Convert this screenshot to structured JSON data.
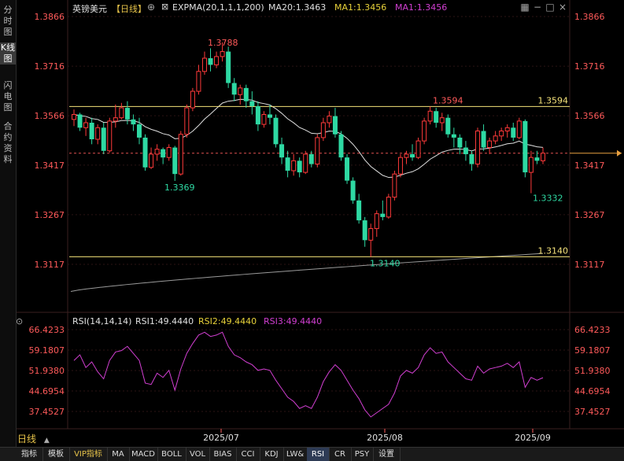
{
  "left_tabs": [
    "分时图",
    "K线图",
    "闪电图",
    "合约资料"
  ],
  "header": {
    "symbol": "英镑美元",
    "period_tag": "【日线】",
    "expma_label": "EXPMA(20,1,1,1,200)",
    "ma20_label": "MA20:1.3463",
    "ma1a_label": "MA1:1.3456",
    "ma1b_label": "MA1:1.3456"
  },
  "rsi_header": {
    "name": "RSI(14,14,14)",
    "rsi1": "RSI1:49.4440",
    "rsi2": "RSI2:49.4440",
    "rsi3": "RSI3:49.4440"
  },
  "colors": {
    "up": "#ff3a3a",
    "down": "#2ed9a3",
    "ema20": "#e0e0e0",
    "ema200": "#9a9a9a",
    "hline": "#f5e27a",
    "rsi": "#d23fd2",
    "axis_label": "#ff5a5a"
  },
  "price_axis": {
    "labels": [
      "1.3866",
      "1.3716",
      "1.3566",
      "1.3417",
      "1.3267",
      "1.3117"
    ],
    "ylim": [
      1.3117,
      1.3866
    ]
  },
  "rsi_axis": {
    "labels": [
      "66.4233",
      "59.1807",
      "51.9380",
      "44.6954",
      "37.4527"
    ],
    "ylim": [
      37.4527,
      66.4233
    ]
  },
  "x_dates": [
    "2025/07",
    "2025/08",
    "2025/09"
  ],
  "annotations": {
    "high_label": "1.3788",
    "low1_label": "1.3369",
    "peak2_label": "1.3594",
    "low2_label": "1.3140",
    "last_low_label": "1.3332",
    "resistance_label": "1.3594",
    "support_label": "1.3140"
  },
  "bottom_period": "日线",
  "bottom_tabs": [
    "指标",
    "模板",
    "VIP指标",
    "MA",
    "MACD",
    "BOLL",
    "VOL",
    "BIAS",
    "CCI",
    "KDJ",
    "LW&",
    "RSI",
    "CR",
    "PSY",
    "设置"
  ],
  "chart_data": {
    "type": "candlestick",
    "title": "英镑美元 日线",
    "ylim": [
      1.3117,
      1.3866
    ],
    "support": 1.314,
    "resistance": 1.3594,
    "current_price": 1.3453,
    "candles": [
      [
        1.3555,
        1.3585,
        1.3535,
        1.357
      ],
      [
        1.357,
        1.3575,
        1.352,
        1.353
      ],
      [
        1.353,
        1.356,
        1.3505,
        1.3545
      ],
      [
        1.3545,
        1.356,
        1.348,
        1.3495
      ],
      [
        1.3495,
        1.354,
        1.348,
        1.353
      ],
      [
        1.353,
        1.3545,
        1.345,
        1.346
      ],
      [
        1.346,
        1.356,
        1.3455,
        1.355
      ],
      [
        1.355,
        1.36,
        1.353,
        1.356
      ],
      [
        1.356,
        1.3605,
        1.3555,
        1.359
      ],
      [
        1.359,
        1.361,
        1.354,
        1.3555
      ],
      [
        1.3555,
        1.357,
        1.352,
        1.354
      ],
      [
        1.354,
        1.356,
        1.348,
        1.35
      ],
      [
        1.35,
        1.351,
        1.34,
        1.341
      ],
      [
        1.341,
        1.347,
        1.3405,
        1.345
      ],
      [
        1.345,
        1.348,
        1.343,
        1.3465
      ],
      [
        1.3465,
        1.347,
        1.342,
        1.344
      ],
      [
        1.344,
        1.348,
        1.343,
        1.347
      ],
      [
        1.347,
        1.3475,
        1.3369,
        1.339
      ],
      [
        1.339,
        1.352,
        1.3385,
        1.351
      ],
      [
        1.351,
        1.36,
        1.35,
        1.359
      ],
      [
        1.359,
        1.365,
        1.358,
        1.364
      ],
      [
        1.364,
        1.372,
        1.363,
        1.37
      ],
      [
        1.37,
        1.376,
        1.369,
        1.374
      ],
      [
        1.374,
        1.377,
        1.37,
        1.372
      ],
      [
        1.372,
        1.376,
        1.371,
        1.3745
      ],
      [
        1.3745,
        1.3788,
        1.373,
        1.376
      ],
      [
        1.376,
        1.3775,
        1.365,
        1.3665
      ],
      [
        1.3665,
        1.368,
        1.361,
        1.363
      ],
      [
        1.363,
        1.366,
        1.36,
        1.365
      ],
      [
        1.365,
        1.366,
        1.359,
        1.361
      ],
      [
        1.361,
        1.364,
        1.357,
        1.3595
      ],
      [
        1.3595,
        1.361,
        1.352,
        1.354
      ],
      [
        1.354,
        1.358,
        1.353,
        1.357
      ],
      [
        1.357,
        1.36,
        1.354,
        1.356
      ],
      [
        1.356,
        1.357,
        1.347,
        1.348
      ],
      [
        1.348,
        1.35,
        1.342,
        1.344
      ],
      [
        1.344,
        1.346,
        1.338,
        1.34
      ],
      [
        1.34,
        1.345,
        1.3385,
        1.343
      ],
      [
        1.343,
        1.344,
        1.338,
        1.3395
      ],
      [
        1.3395,
        1.346,
        1.339,
        1.345
      ],
      [
        1.345,
        1.346,
        1.341,
        1.342
      ],
      [
        1.342,
        1.351,
        1.341,
        1.35
      ],
      [
        1.35,
        1.356,
        1.349,
        1.3545
      ],
      [
        1.3545,
        1.358,
        1.353,
        1.3565
      ],
      [
        1.3565,
        1.359,
        1.35,
        1.351
      ],
      [
        1.351,
        1.352,
        1.343,
        1.344
      ],
      [
        1.344,
        1.345,
        1.336,
        1.337
      ],
      [
        1.337,
        1.338,
        1.33,
        1.331
      ],
      [
        1.331,
        1.333,
        1.324,
        1.325
      ],
      [
        1.325,
        1.326,
        1.317,
        1.319
      ],
      [
        1.319,
        1.324,
        1.314,
        1.3225
      ],
      [
        1.3225,
        1.328,
        1.32,
        1.327
      ],
      [
        1.327,
        1.331,
        1.325,
        1.326
      ],
      [
        1.326,
        1.333,
        1.3255,
        1.332
      ],
      [
        1.332,
        1.34,
        1.331,
        1.339
      ],
      [
        1.339,
        1.345,
        1.338,
        1.344
      ],
      [
        1.344,
        1.346,
        1.342,
        1.345
      ],
      [
        1.345,
        1.348,
        1.343,
        1.344
      ],
      [
        1.344,
        1.35,
        1.3435,
        1.349
      ],
      [
        1.349,
        1.356,
        1.348,
        1.355
      ],
      [
        1.355,
        1.3594,
        1.354,
        1.358
      ],
      [
        1.358,
        1.359,
        1.353,
        1.3545
      ],
      [
        1.3545,
        1.3575,
        1.352,
        1.356
      ],
      [
        1.356,
        1.357,
        1.35,
        1.351
      ],
      [
        1.351,
        1.353,
        1.347,
        1.35
      ],
      [
        1.35,
        1.351,
        1.345,
        1.347
      ],
      [
        1.347,
        1.349,
        1.343,
        1.345
      ],
      [
        1.345,
        1.346,
        1.34,
        1.342
      ],
      [
        1.342,
        1.353,
        1.341,
        1.352
      ],
      [
        1.352,
        1.354,
        1.346,
        1.347
      ],
      [
        1.347,
        1.35,
        1.345,
        1.349
      ],
      [
        1.349,
        1.352,
        1.348,
        1.3505
      ],
      [
        1.3505,
        1.353,
        1.349,
        1.352
      ],
      [
        1.352,
        1.354,
        1.35,
        1.353
      ],
      [
        1.353,
        1.3545,
        1.349,
        1.35
      ],
      [
        1.35,
        1.356,
        1.3495,
        1.355
      ],
      [
        1.355,
        1.3555,
        1.338,
        1.3395
      ],
      [
        1.3395,
        1.346,
        1.3332,
        1.344
      ],
      [
        1.344,
        1.346,
        1.342,
        1.343
      ],
      [
        1.343,
        1.347,
        1.342,
        1.3453
      ]
    ],
    "rsi": [
      55.5,
      57.5,
      53.0,
      55.0,
      51.5,
      49.0,
      55.5,
      58.5,
      59.0,
      60.5,
      58.0,
      55.5,
      47.5,
      47.0,
      51.0,
      49.5,
      52.0,
      45.0,
      52.5,
      58.0,
      61.5,
      64.5,
      65.5,
      64.0,
      64.5,
      65.5,
      60.5,
      57.5,
      56.5,
      55.0,
      54.0,
      52.0,
      52.5,
      52.0,
      48.5,
      45.5,
      42.5,
      41.0,
      38.5,
      39.5,
      38.5,
      42.5,
      48.0,
      51.5,
      54.0,
      52.0,
      48.5,
      45.0,
      42.0,
      38.0,
      35.5,
      37.0,
      38.5,
      40.0,
      44.0,
      50.0,
      52.0,
      51.0,
      53.0,
      57.5,
      60.0,
      58.0,
      58.5,
      55.0,
      53.0,
      51.0,
      49.0,
      48.5,
      53.5,
      51.0,
      52.5,
      53.0,
      53.5,
      54.5,
      53.0,
      55.0,
      46.0,
      49.5,
      48.5,
      49.4
    ]
  }
}
